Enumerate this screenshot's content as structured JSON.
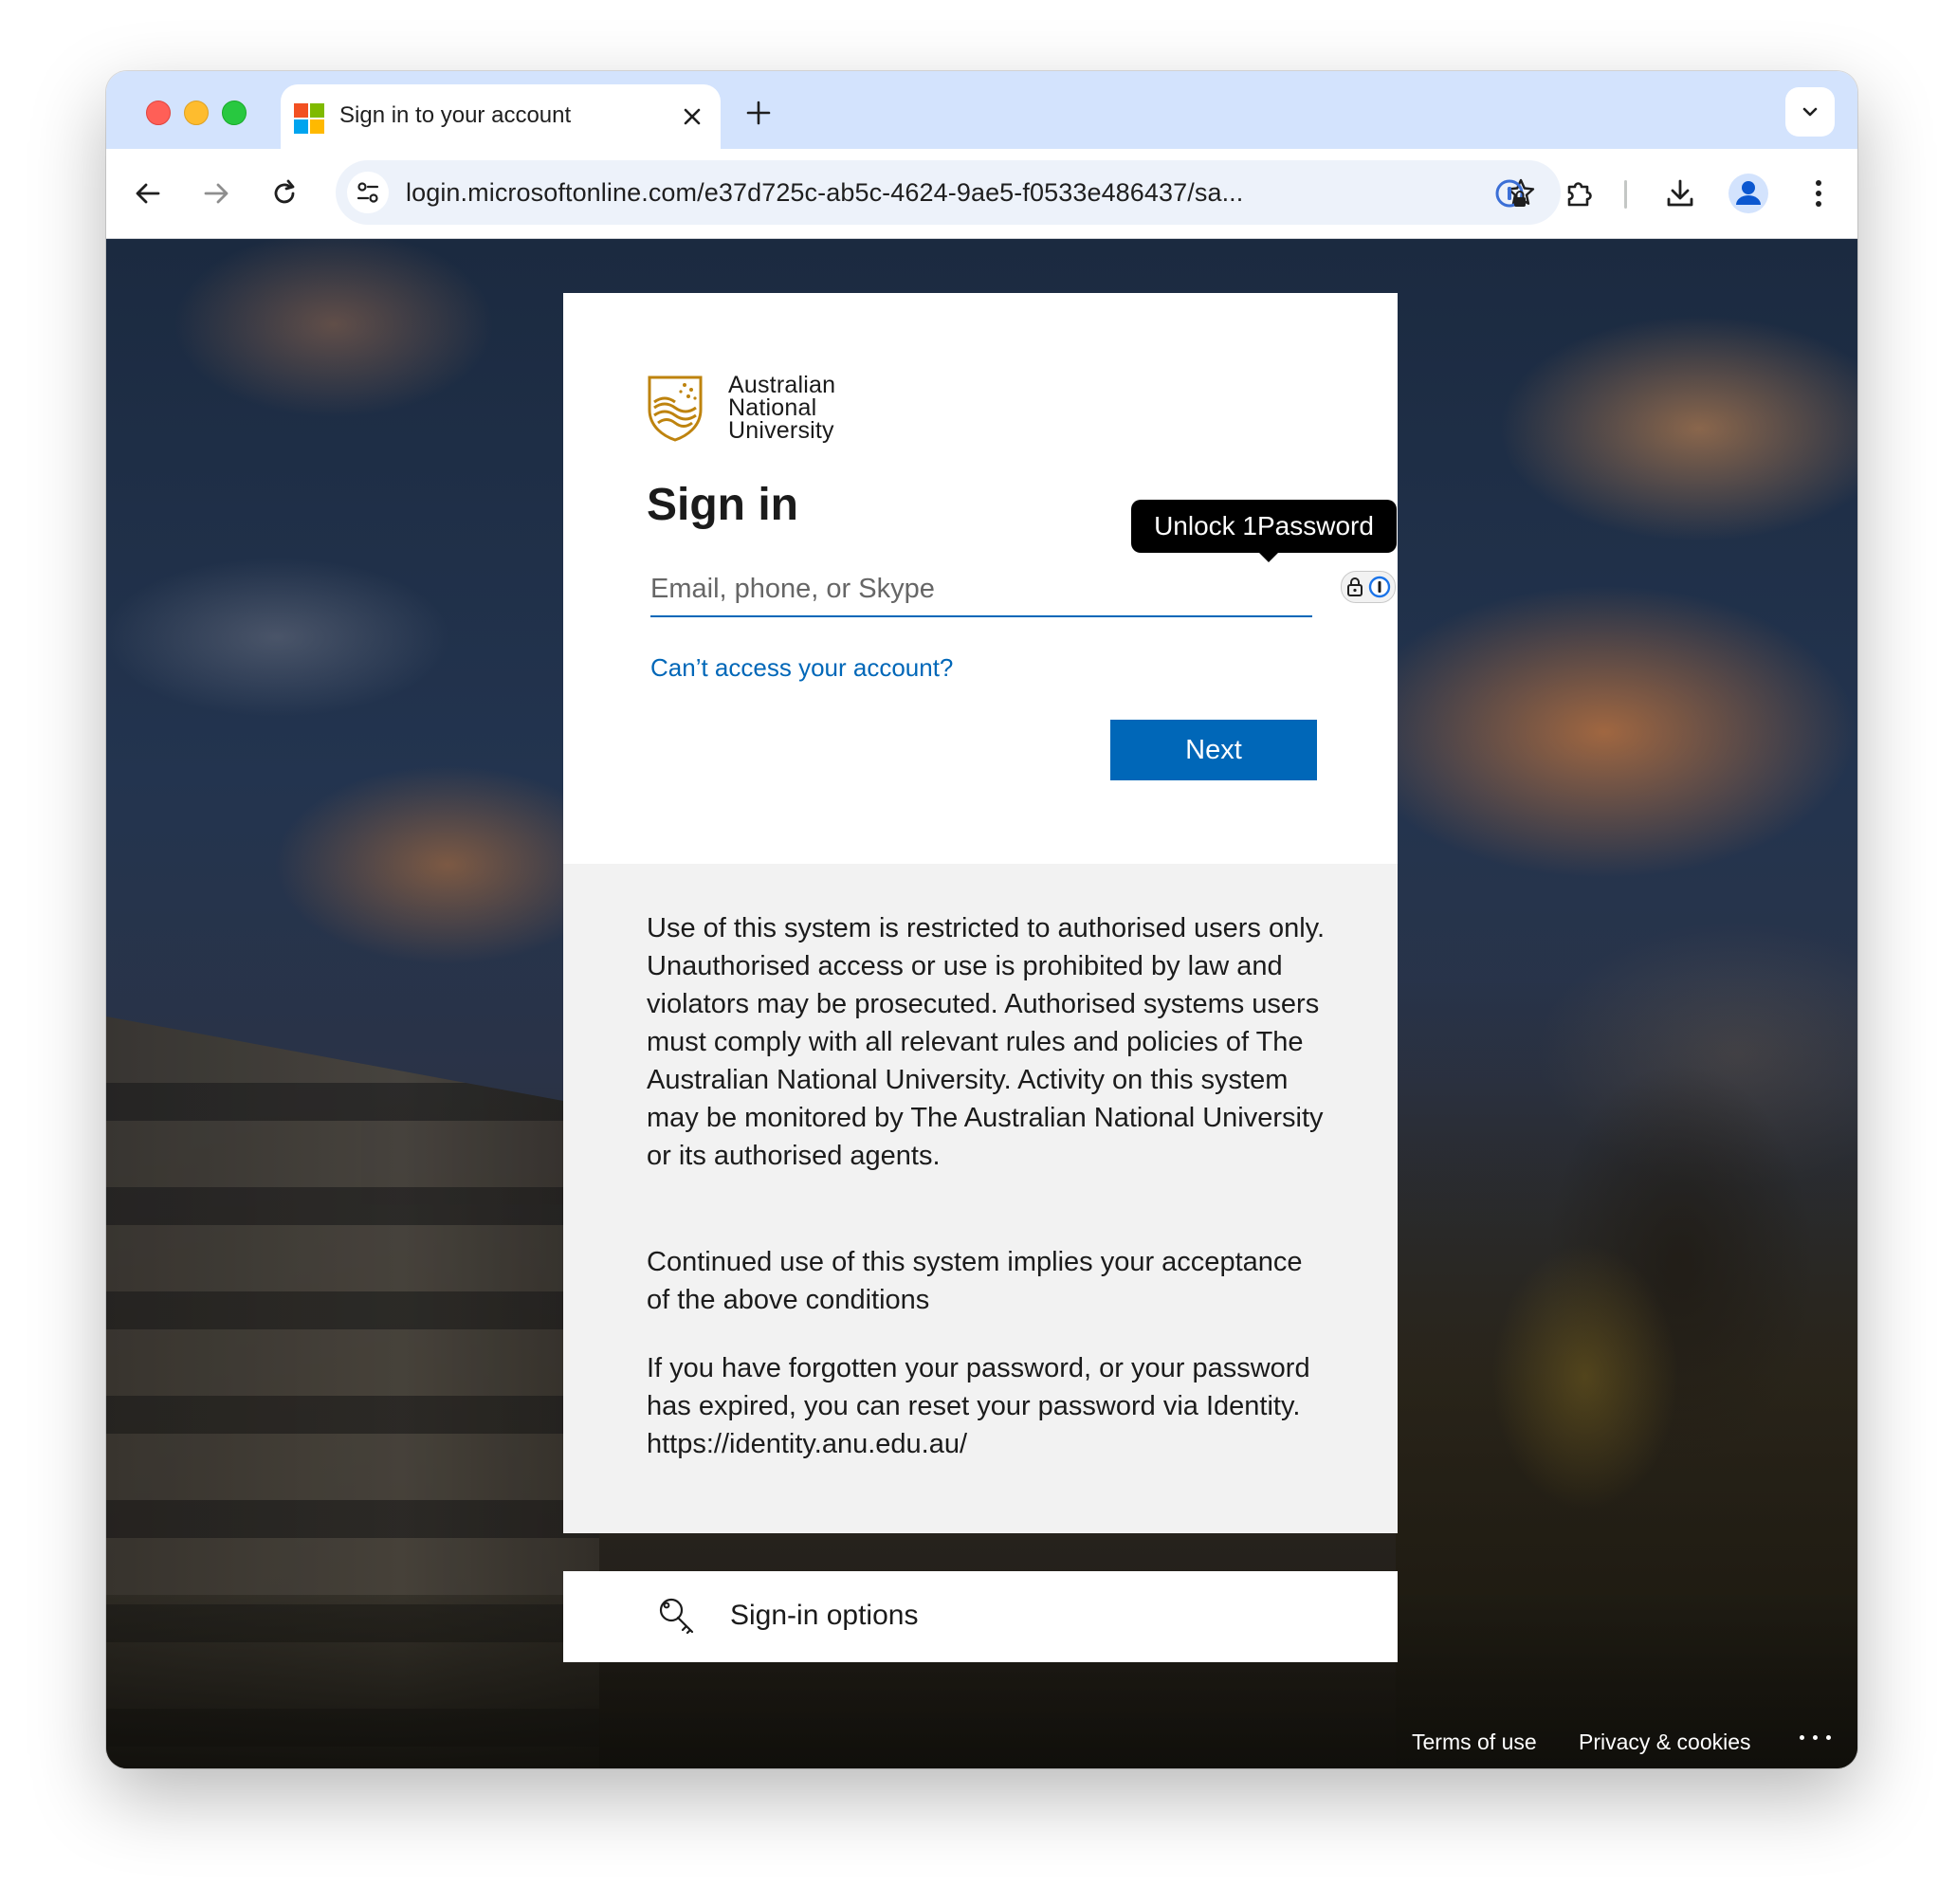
{
  "browser": {
    "tab": {
      "title": "Sign in to your account",
      "favicon": "microsoft-logo-icon"
    },
    "address_bar": {
      "url": "login.microsoftonline.com/e37d725c-ab5c-4624-9ae5-f0533e486437/sa..."
    },
    "toolbar_icons": [
      "back-arrow-icon",
      "forward-arrow-icon",
      "reload-icon",
      "site-settings-icon",
      "bookmark-star-icon",
      "1password-extension-icon",
      "extensions-puzzle-icon",
      "download-icon",
      "profile-avatar-icon",
      "more-menu-icon"
    ]
  },
  "signin": {
    "logo": {
      "line1": "Australian",
      "line2": "National",
      "line3": "University"
    },
    "heading": "Sign in",
    "email_placeholder": "Email, phone, or Skype",
    "email_value": "",
    "onepassword_tooltip": "Unlock 1Password",
    "cant_access": "Can’t access your account?",
    "next_label": "Next",
    "notice": [
      "Use of this system is restricted to authorised users only. Unauthorised access or use is prohibited by law and violators may be prosecuted. Authorised systems users must comply with all relevant rules and policies of The Australian National University. Activity on this system may be monitored by The Australian National University or its authorised agents.",
      "Continued use of this system implies your acceptance of the above conditions",
      "If you have forgotten your password, or your password has expired, you can reset your password via Identity. https://identity.anu.edu.au/"
    ]
  },
  "options": {
    "label": "Sign-in options"
  },
  "footer": {
    "terms": "Terms of use",
    "privacy": "Privacy & cookies",
    "more": "..."
  },
  "colors": {
    "accent": "#0067b8",
    "tabstrip": "#d3e3fd",
    "anu_gold": "#be830e"
  }
}
